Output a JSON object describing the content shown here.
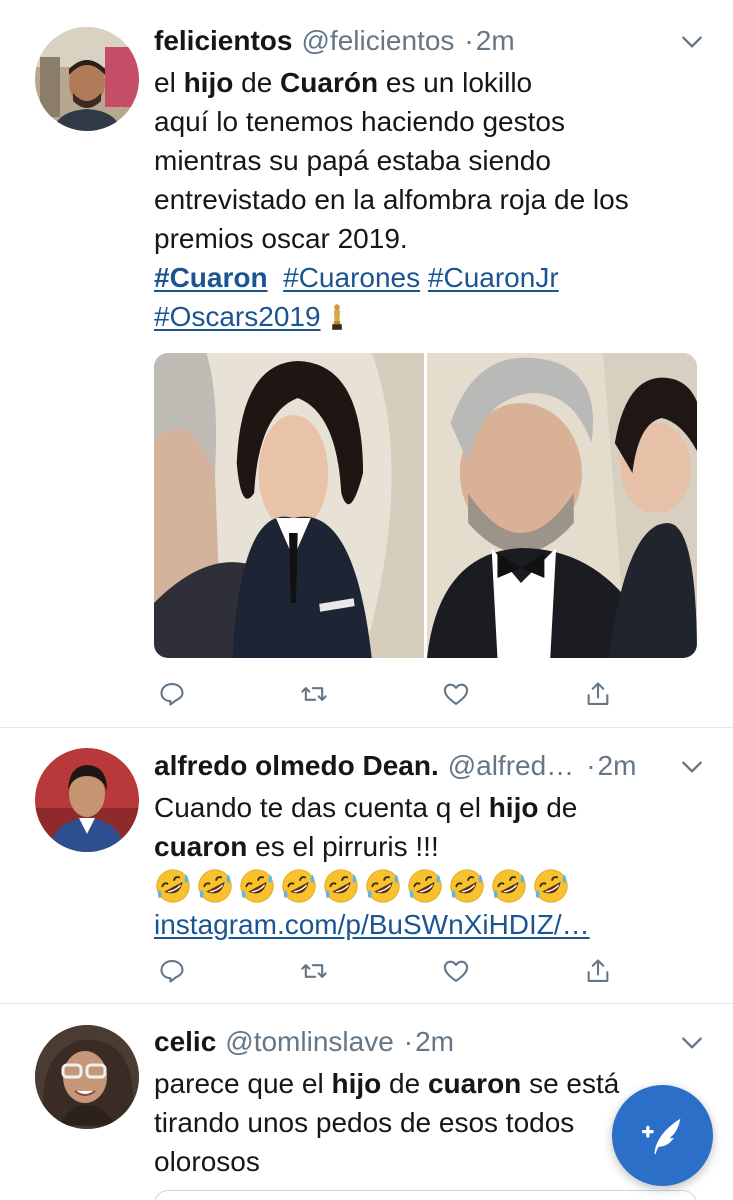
{
  "tweets": [
    {
      "name": "felicientos",
      "handle": "@felicientos",
      "separator": "·",
      "time": "2m",
      "text_lines": [
        [
          "el ",
          "hijo",
          " de ",
          "Cuarón",
          " es un lokillo"
        ],
        "aquí lo tenemos haciendo gestos",
        "mientras su papá estaba siendo",
        "entrevistado en la alfombra roja de los",
        "premios oscar 2019."
      ],
      "hashtags": [
        "#Cuaron",
        "#Cuarones",
        "#CuaronJr",
        "#Oscars2019"
      ],
      "trophy_icon": "trophy-icon"
    },
    {
      "name": "alfredo olmedo Dean.",
      "handle": "@alfred…",
      "separator": "·",
      "time": "2m",
      "text_a": "Cuando te das cuenta q el ",
      "text_b": "hijo",
      "text_c": " de",
      "text_d": "cuaron",
      "text_e": " es el pirruris !!!",
      "emoji_icon": "rolling-on-floor-laughing-icon",
      "emoji_count": 10,
      "link": "instagram.com/p/BuSWnXiHDIZ/…"
    },
    {
      "name": "celic",
      "handle": "@tomlinslave",
      "separator": "·",
      "time": "2m",
      "text_a": "parece que el ",
      "text_b": "hijo",
      "text_c": " de ",
      "text_d": "cuaron",
      "text_e": " se está",
      "line2": "tirando unos pedos de esos todos",
      "line3": "olorosos"
    }
  ],
  "actions": [
    "reply-icon",
    "retweet-icon",
    "like-icon",
    "share-icon"
  ],
  "compose_icon": "compose-tweet-icon",
  "colors": {
    "link": "#1b5591",
    "muted": "#657786",
    "fab": "#2b6fc8"
  }
}
